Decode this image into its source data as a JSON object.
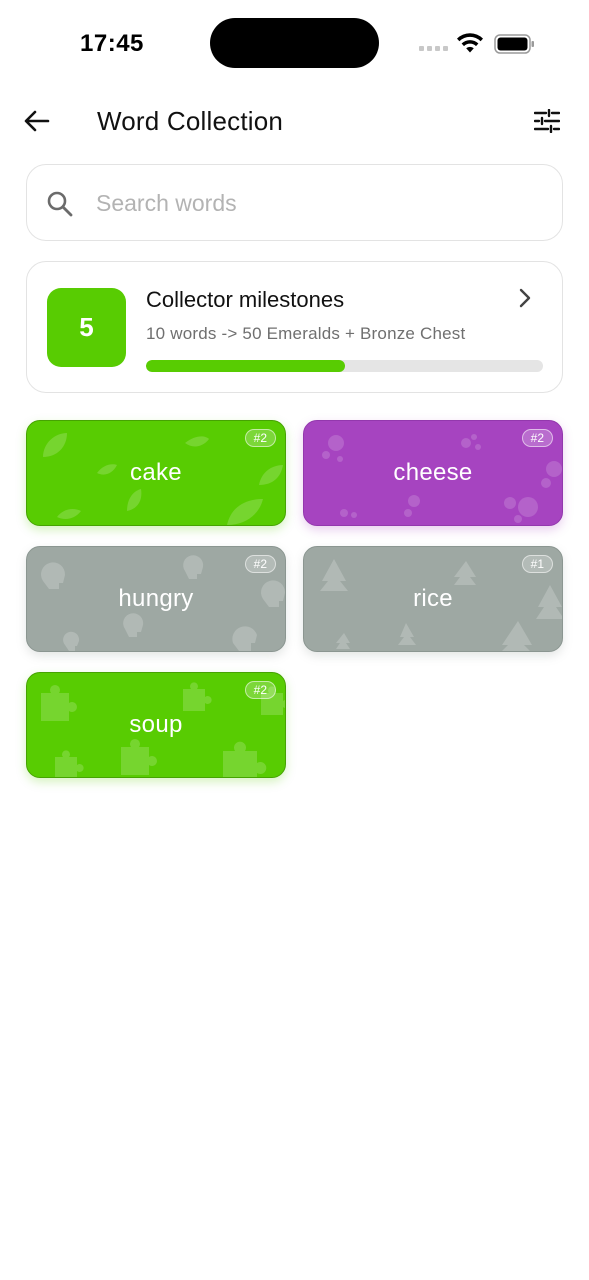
{
  "status_bar": {
    "time": "17:45"
  },
  "header": {
    "title": "Word Collection"
  },
  "search": {
    "placeholder": "Search words",
    "value": ""
  },
  "milestone": {
    "level": "5",
    "title": "Collector milestones",
    "subtitle": "10 words -> 50 Emeralds + Bronze Chest",
    "progress_fraction": 0.5
  },
  "cards": [
    {
      "word": "cake",
      "rank": "#2",
      "theme": "green",
      "pattern": "leaf"
    },
    {
      "word": "cheese",
      "rank": "#2",
      "theme": "purple",
      "pattern": "bubbles"
    },
    {
      "word": "hungry",
      "rank": "#2",
      "theme": "gray",
      "pattern": "head"
    },
    {
      "word": "rice",
      "rank": "#1",
      "theme": "gray",
      "pattern": "tree"
    },
    {
      "word": "soup",
      "rank": "#2",
      "theme": "green",
      "pattern": "puzzle"
    }
  ],
  "colors": {
    "accent_green": "#58cc02",
    "accent_purple": "#a644c0",
    "locked_gray": "#9ea8a3",
    "progress_track": "#e5e5e5"
  },
  "icons": {
    "back": "arrow-left-icon",
    "filter": "sliders-icon",
    "search": "search-icon",
    "chevron": "chevron-right-icon"
  }
}
